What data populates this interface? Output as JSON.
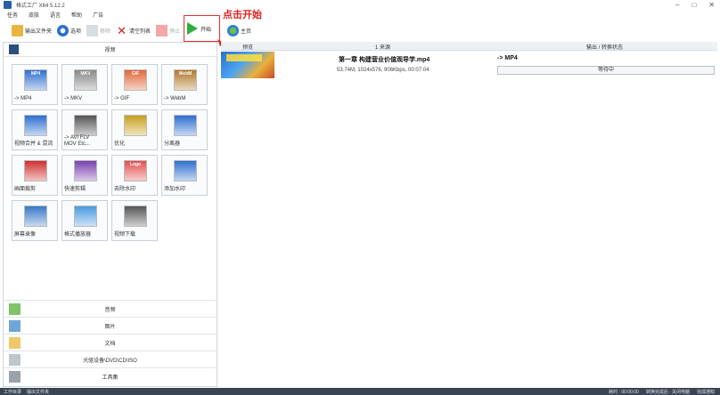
{
  "window": {
    "title": "格式工厂 X64 5.12.2",
    "controls": [
      "–",
      "□",
      "✕"
    ]
  },
  "menu": [
    "任务",
    "皮肤",
    "语言",
    "帮助",
    "广告"
  ],
  "toolbar": {
    "output_folder": "输出文件夹",
    "options": "选项",
    "remove": "移除",
    "clear_list": "清空列表",
    "stop": "停止",
    "start": "开始",
    "home": "主页"
  },
  "annotation": "点击开始",
  "left": {
    "video_header": "视频",
    "tiles": [
      {
        "label": "-> MP4",
        "icon": "mp4-icon",
        "badge": "MP4",
        "color": "#2f6fd0"
      },
      {
        "label": "-> MKV",
        "icon": "mkv-icon",
        "badge": "MKV",
        "color": "#888888"
      },
      {
        "label": "-> GIF",
        "icon": "gif-icon",
        "badge": "GIF",
        "color": "#e0653a"
      },
      {
        "label": "-> WebM",
        "icon": "webm-icon",
        "badge": "WebM",
        "color": "#b0782a"
      },
      {
        "label": "视频合并 & 混流",
        "icon": "video-merge-icon",
        "badge": "",
        "color": "#2f6fd0"
      },
      {
        "label": "-> AVI FLV\nMOV Etc...",
        "icon": "avi-flv-mov-icon",
        "badge": "",
        "color": "#555555"
      },
      {
        "label": "优化",
        "icon": "optimize-icon",
        "badge": "",
        "color": "#c8a020"
      },
      {
        "label": "分离器",
        "icon": "splitter-icon",
        "badge": "",
        "color": "#2f6fd0"
      },
      {
        "label": "画面裁剪",
        "icon": "crop-icon",
        "badge": "",
        "color": "#d03030"
      },
      {
        "label": "快速剪辑",
        "icon": "quick-clip-icon",
        "badge": "",
        "color": "#7a40b0"
      },
      {
        "label": "去除水印",
        "icon": "remove-watermark-icon",
        "badge": "Logo",
        "color": "#e05050"
      },
      {
        "label": "添加水印",
        "icon": "add-watermark-icon",
        "badge": "",
        "color": "#2f6fd0"
      },
      {
        "label": "屏幕录像",
        "icon": "screen-record-icon",
        "badge": "",
        "color": "#3a78c8"
      },
      {
        "label": "格式播放器",
        "icon": "format-player-icon",
        "badge": "",
        "color": "#4a9ae0"
      },
      {
        "label": "视频下载",
        "icon": "video-download-icon",
        "badge": "",
        "color": "#555555"
      }
    ],
    "sections": [
      {
        "label": "音频",
        "icon": "audio-icon"
      },
      {
        "label": "图片",
        "icon": "picture-icon"
      },
      {
        "label": "文档",
        "icon": "document-icon"
      },
      {
        "label": "光驱设备\\DVD\\CD\\ISO",
        "icon": "disc-icon"
      },
      {
        "label": "工具集",
        "icon": "toolbox-icon"
      }
    ]
  },
  "right": {
    "columns": {
      "preview": "预览",
      "source": "1 来源",
      "output": "输出 / 转换状态"
    },
    "rows": [
      {
        "filename": "第一章 构建营业价值观导学.mp4",
        "info": "53.74M, 1024x576, 906Kbps, 00:07:04",
        "format": "-> MP4",
        "status": "等待中"
      }
    ]
  },
  "statusbar": {
    "left": [
      "工作目录",
      "输出文件夹"
    ],
    "right": [
      "耗时 : 00:00:00",
      "转换完成后 : 关闭电脑",
      "完成通知"
    ]
  },
  "colors": {
    "annotation": "#e02020",
    "start_border": "#e03030",
    "play": "#2fae3d",
    "statusbar_bg": "#3b4452"
  }
}
